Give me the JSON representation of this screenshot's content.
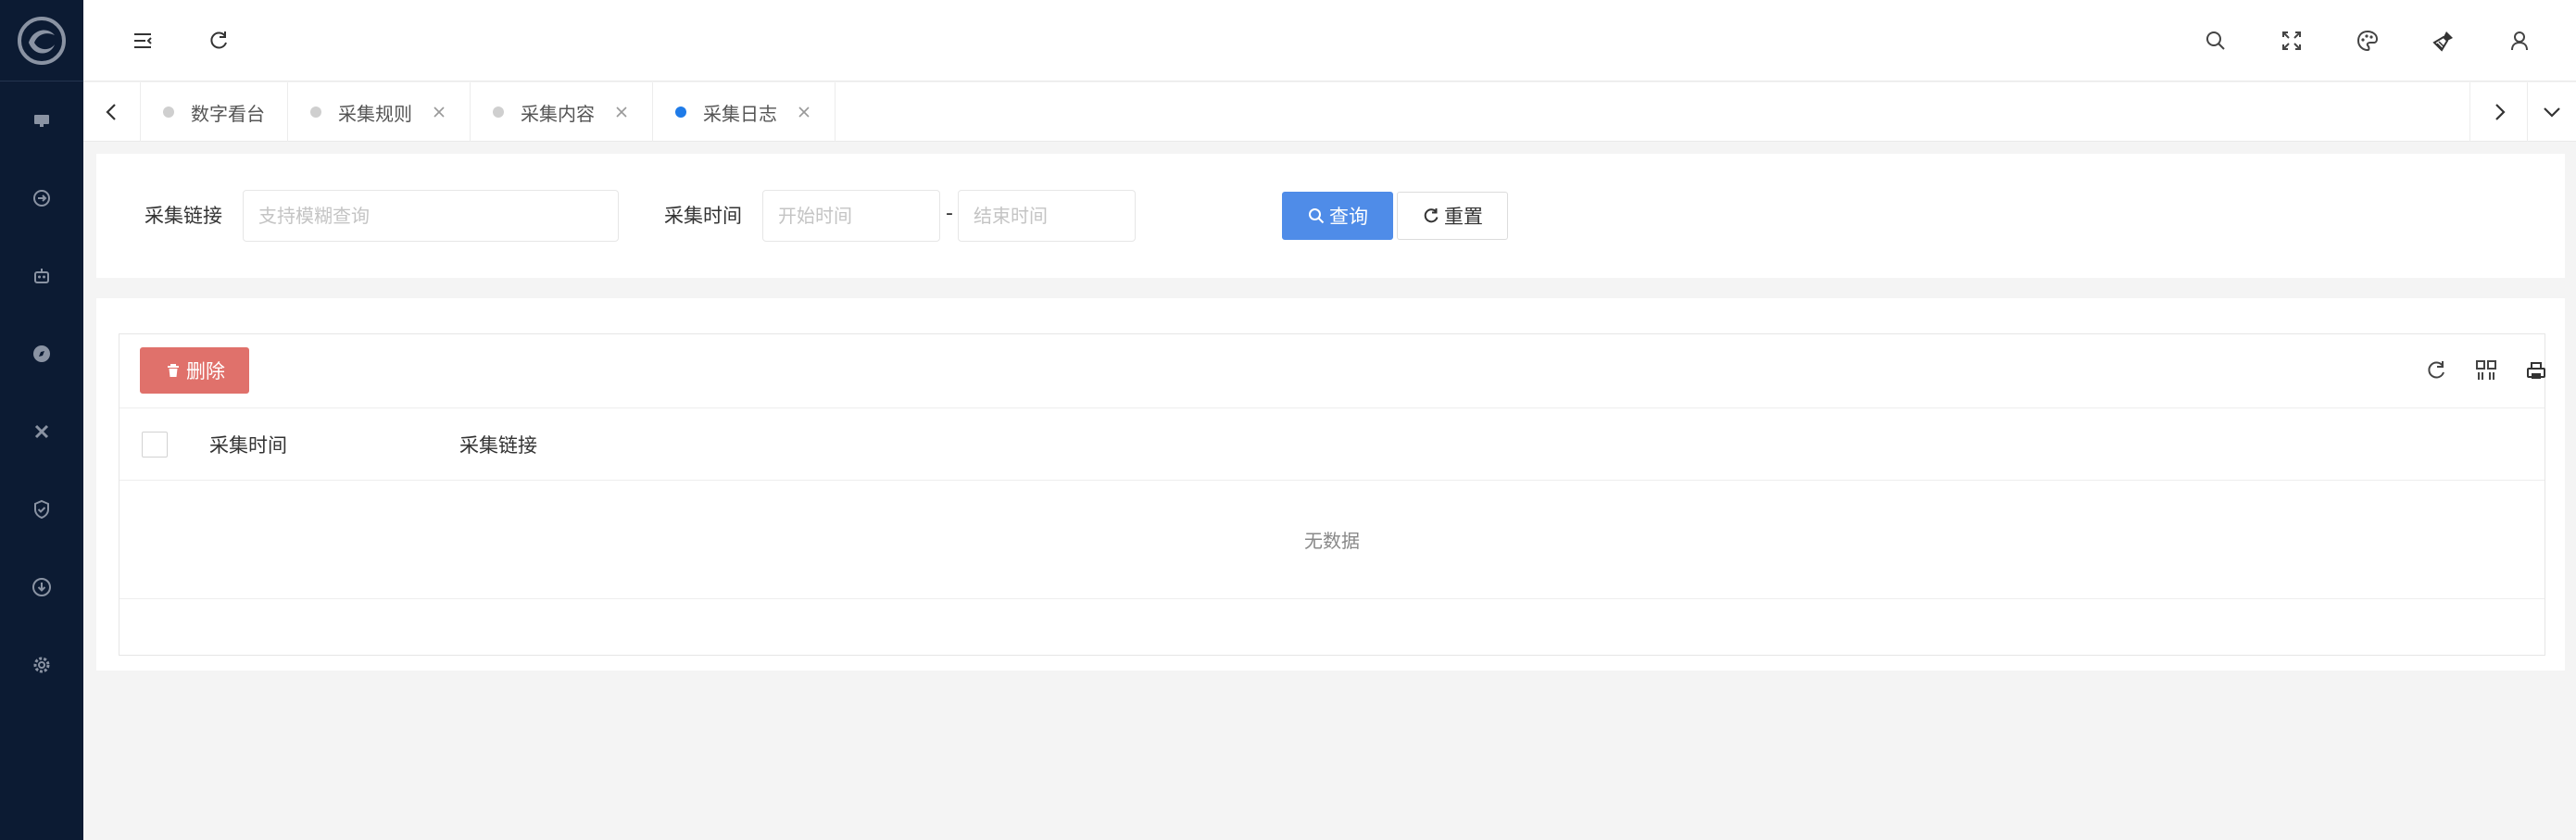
{
  "colors": {
    "sidebar_bg": "#0c1b33",
    "primary": "#4f8ce8",
    "danger": "#e0716b",
    "active_tab_dot": "#1f7be8"
  },
  "sidebar": {
    "items": [
      {
        "icon": "monitor-icon"
      },
      {
        "icon": "link-icon"
      },
      {
        "icon": "robot-icon"
      },
      {
        "icon": "compass-icon"
      },
      {
        "icon": "tools-icon"
      },
      {
        "icon": "shield-check-icon"
      },
      {
        "icon": "download-icon"
      },
      {
        "icon": "gear-icon"
      }
    ]
  },
  "header": {
    "left_icons": [
      "menu-fold-icon",
      "refresh-icon"
    ],
    "right_icons": [
      "search-icon",
      "fullscreen-icon",
      "palette-icon",
      "brush-icon",
      "user-icon"
    ]
  },
  "tabs": [
    {
      "label": "数字看台",
      "active": false,
      "closable": false
    },
    {
      "label": "采集规则",
      "active": false,
      "closable": true
    },
    {
      "label": "采集内容",
      "active": false,
      "closable": true
    },
    {
      "label": "采集日志",
      "active": true,
      "closable": true
    }
  ],
  "search": {
    "link_label": "采集链接",
    "link_placeholder": "支持模糊查询",
    "time_label": "采集时间",
    "start_placeholder": "开始时间",
    "separator": "-",
    "end_placeholder": "结束时间",
    "query_label": "查询",
    "reset_label": "重置"
  },
  "table": {
    "delete_label": "删除",
    "columns": [
      "采集时间",
      "采集链接"
    ],
    "rows": [],
    "empty_text": "无数据",
    "toolbar_icons": [
      "refresh-icon",
      "columns-icon",
      "print-icon"
    ]
  }
}
